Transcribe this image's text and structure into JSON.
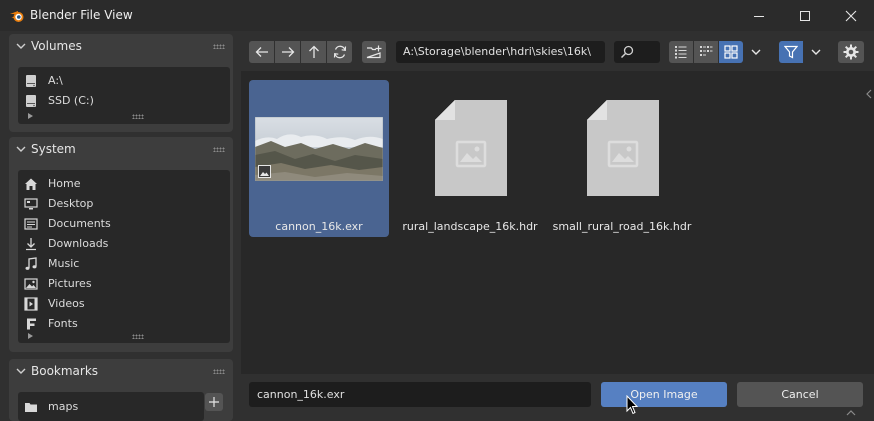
{
  "window": {
    "title": "Blender File View"
  },
  "sidebar": {
    "volumes": {
      "title": "Volumes",
      "items": [
        {
          "label": "A:\\",
          "icon": "drive-icon"
        },
        {
          "label": "SSD (C:)",
          "icon": "drive-icon"
        }
      ]
    },
    "system": {
      "title": "System",
      "items": [
        {
          "label": "Home",
          "icon": "home-icon"
        },
        {
          "label": "Desktop",
          "icon": "desktop-icon"
        },
        {
          "label": "Documents",
          "icon": "documents-icon"
        },
        {
          "label": "Downloads",
          "icon": "downloads-icon"
        },
        {
          "label": "Music",
          "icon": "music-icon"
        },
        {
          "label": "Pictures",
          "icon": "pictures-icon"
        },
        {
          "label": "Videos",
          "icon": "videos-icon"
        },
        {
          "label": "Fonts",
          "icon": "fonts-icon"
        }
      ]
    },
    "bookmarks": {
      "title": "Bookmarks",
      "items": [
        {
          "label": "maps",
          "icon": "folder-icon"
        }
      ]
    }
  },
  "toolbar": {
    "path": "A:\\Storage\\blender\\hdri\\skies\\16k\\",
    "view_mode": "thumbnails"
  },
  "files": [
    {
      "name": "cannon_16k.exr",
      "selected": true,
      "has_preview": true
    },
    {
      "name": "rural_landscape_16k.hdr",
      "selected": false,
      "has_preview": false
    },
    {
      "name": "small_rural_road_16k.hdr",
      "selected": false,
      "has_preview": false
    }
  ],
  "footer": {
    "filename": "cannon_16k.exr",
    "open_label": "Open Image",
    "cancel_label": "Cancel"
  },
  "colors": {
    "accent": "#4772b3",
    "selection": "#4a6491",
    "primary_button": "#5680c2"
  }
}
